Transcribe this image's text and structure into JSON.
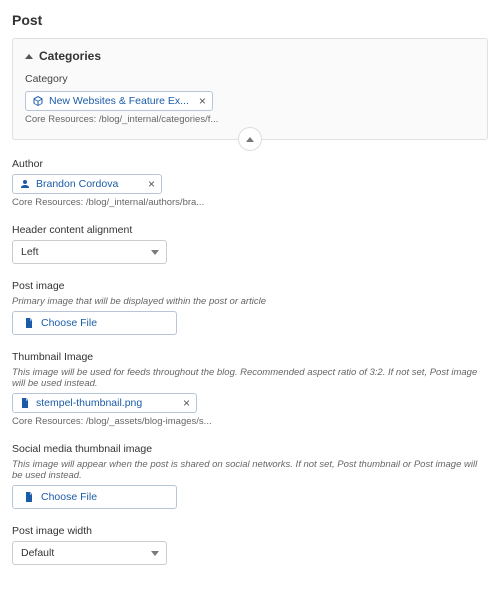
{
  "page": {
    "title": "Post"
  },
  "categories": {
    "heading": "Categories",
    "field_label": "Category",
    "chip": {
      "label": "New Websites & Feature Ex..."
    },
    "path": "Core Resources: /blog/_internal/categories/f..."
  },
  "author": {
    "label": "Author",
    "chip": {
      "label": "Brandon Cordova"
    },
    "path": "Core Resources: /blog/_internal/authors/bra..."
  },
  "header_align": {
    "label": "Header content alignment",
    "value": "Left"
  },
  "post_image": {
    "label": "Post image",
    "hint": "Primary image that will be displayed within the post or article",
    "button": "Choose File"
  },
  "thumb_image": {
    "label": "Thumbnail Image",
    "hint": "This image will be used for feeds throughout the blog. Recommended aspect ratio of 3:2. If not set, Post image will be used instead.",
    "chip": {
      "label": "stempel-thumbnail.png"
    },
    "path": "Core Resources: /blog/_assets/blog-images/s..."
  },
  "social_image": {
    "label": "Social media thumbnail image",
    "hint": "This image will appear when the post is shared on social networks. If not set, Post thumbnail or Post image will be used instead.",
    "button": "Choose File"
  },
  "image_width": {
    "label": "Post image width",
    "value": "Default"
  }
}
